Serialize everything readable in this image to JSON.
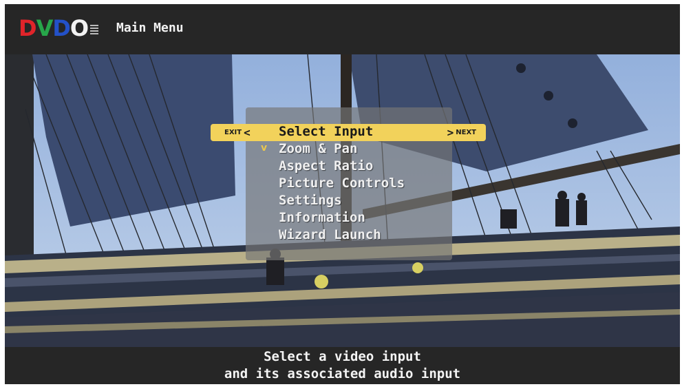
{
  "header": {
    "logo_letters": [
      {
        "char": "D",
        "color": "#e0242a"
      },
      {
        "char": "V",
        "color": "#27a64a"
      },
      {
        "char": "D",
        "color": "#2351c8"
      },
      {
        "char": "O",
        "color": "#f2f2f2"
      }
    ],
    "title": "Main Menu"
  },
  "menu": {
    "exit_label": "EXIT",
    "next_label": "NEXT",
    "exit_arrow": "<",
    "next_arrow": ">",
    "scroll_indicator": "v",
    "items": [
      {
        "label": "Select Input",
        "selected": true
      },
      {
        "label": "Zoom & Pan"
      },
      {
        "label": "Aspect Ratio"
      },
      {
        "label": "Picture Controls"
      },
      {
        "label": "Settings"
      },
      {
        "label": "Information"
      },
      {
        "label": "Wizard Launch"
      }
    ]
  },
  "help": {
    "line1": "Select a video input",
    "line2": "and its associated audio input"
  },
  "colors": {
    "highlight": "#f2d25b",
    "bar": "#262626",
    "sky": "#a9c0e2",
    "sail": "#3a4a6e"
  }
}
